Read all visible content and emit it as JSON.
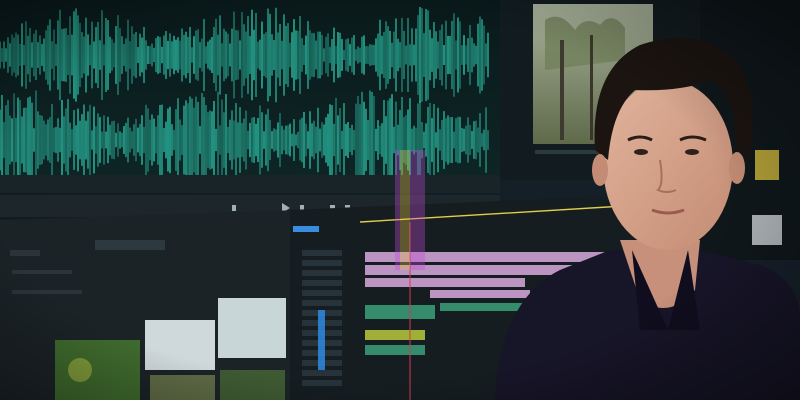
{
  "scene": {
    "description_colors": {
      "waveform": "#2fd1b4",
      "panel_dark": "#1a2328",
      "timeline_pink": "#d9a9dd",
      "timeline_green": "#3aa07a",
      "timeline_yellow": "#b8c93b",
      "timecode_blue": "#3fa0ff",
      "shirt": "#161426",
      "hair": "#1a1512",
      "skin": "#d7a28b"
    },
    "icons": [
      "play-icon",
      "step-back-icon",
      "step-forward-icon",
      "marker-icon"
    ]
  }
}
